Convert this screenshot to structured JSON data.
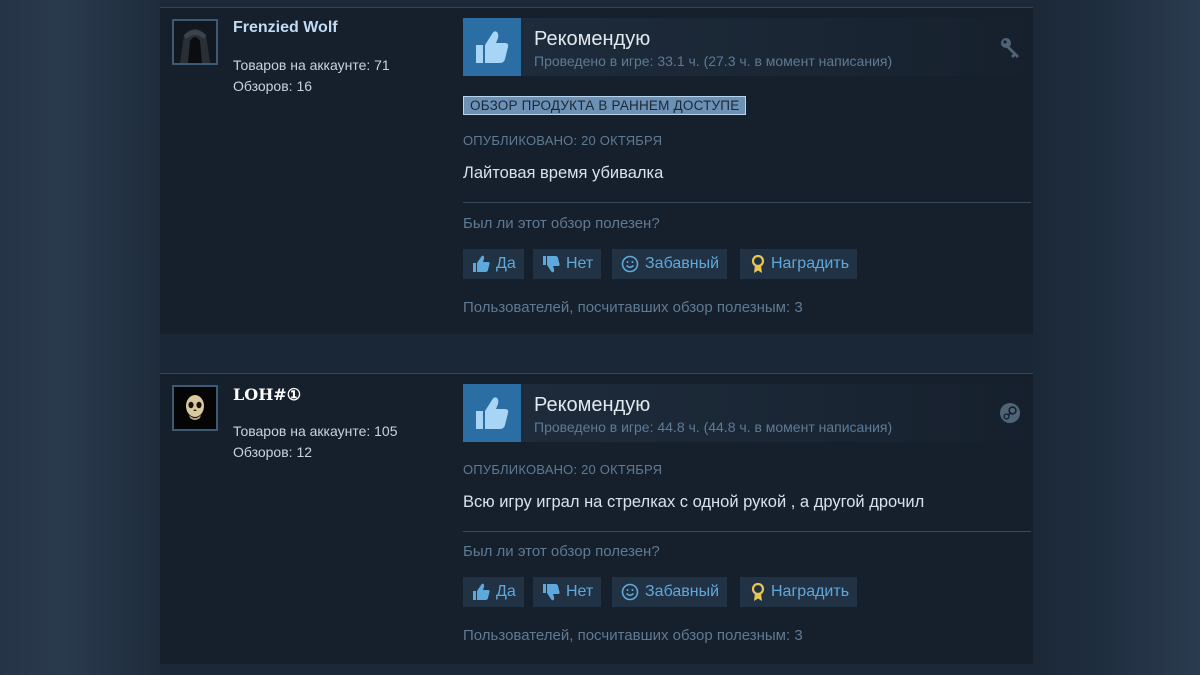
{
  "reviews": [
    {
      "author_name": "Frenzied Wolf",
      "products": "Товаров на аккаунте: 71",
      "reviews": "Обзоров: 16",
      "vote": "Рекомендую",
      "playtime": "Проведено в игре: 33.1 ч. (27.3 ч. в момент написания)",
      "early_access_badge": "ОБЗОР ПРОДУКТА В РАННЕМ ДОСТУПЕ",
      "posted": "ОПУБЛИКОВАНО: 20 ОКТЯБРЯ",
      "text": "Лайтовая время убивалка",
      "helpful_question": "Был ли этот обзор полезен?",
      "btn_yes": "Да",
      "btn_no": "Нет",
      "btn_funny": "Забавный",
      "btn_award": "Наградить",
      "helpful_count": "Пользователей, посчитавших обзор полезным: 3",
      "source_icon": "key-icon"
    },
    {
      "author_name": "LOH#①",
      "products": "Товаров на аккаунте: 105",
      "reviews": "Обзоров: 12",
      "vote": "Рекомендую",
      "playtime": "Проведено в игре: 44.8 ч. (44.8 ч. в момент написания)",
      "posted": "ОПУБЛИКОВАНО: 20 ОКТЯБРЯ",
      "text": "Всю игру играл на стрелках с одной рукой , а другой дрочил",
      "helpful_question": "Был ли этот обзор полезен?",
      "btn_yes": "Да",
      "btn_no": "Нет",
      "btn_funny": "Забавный",
      "btn_award": "Наградить",
      "helpful_count": "Пользователей, посчитавших обзор полезным: 3",
      "source_icon": "steam-icon"
    }
  ],
  "colors": {
    "page_bg": "#1b2838",
    "card_bg": "#16202d",
    "thumb_blue": "#2b6ea3",
    "button_text": "#5fa8dc",
    "muted_text": "#5f7a93",
    "award_gold": "#e8c550"
  }
}
